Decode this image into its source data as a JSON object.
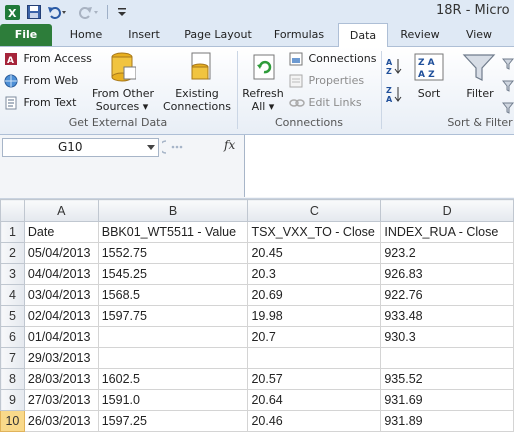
{
  "window": {
    "title": "18R - Micro"
  },
  "ribbon_tabs": [
    "File",
    "Home",
    "Insert",
    "Page Layout",
    "Formulas",
    "Data",
    "Review",
    "View"
  ],
  "active_tab": "Data",
  "get_external_data": {
    "from_access": "From Access",
    "from_web": "From Web",
    "from_text": "From Text",
    "from_other_sources_1": "From Other",
    "from_other_sources_2": "Sources ▾",
    "existing_connections_1": "Existing",
    "existing_connections_2": "Connections",
    "group_label": "Get External Data"
  },
  "connections": {
    "refresh_all_1": "Refresh",
    "refresh_all_2": "All ▾",
    "connections": "Connections",
    "properties": "Properties",
    "edit_links": "Edit Links",
    "group_label": "Connections"
  },
  "sort_filter": {
    "sort": "Sort",
    "filter": "Filter",
    "group_label": "Sort & Filter"
  },
  "formula_bar": {
    "name_box": "G10",
    "fx": "fx",
    "formula": ""
  },
  "sheet": {
    "columns": [
      "A",
      "B",
      "C",
      "D"
    ],
    "rows": [
      {
        "n": "1",
        "a": "Date",
        "b": "BBK01_WT5511 - Value",
        "c": "TSX_VXX_TO - Close",
        "d": "INDEX_RUA - Close"
      },
      {
        "n": "2",
        "a": "05/04/2013",
        "b": "1552.75",
        "c": "20.45",
        "d": "923.2"
      },
      {
        "n": "3",
        "a": "04/04/2013",
        "b": "1545.25",
        "c": "20.3",
        "d": "926.83"
      },
      {
        "n": "4",
        "a": "03/04/2013",
        "b": "1568.5",
        "c": "20.69",
        "d": "922.76"
      },
      {
        "n": "5",
        "a": "02/04/2013",
        "b": "1597.75",
        "c": "19.98",
        "d": "933.48"
      },
      {
        "n": "6",
        "a": "01/04/2013",
        "b": "",
        "c": "20.7",
        "d": "930.3"
      },
      {
        "n": "7",
        "a": "29/03/2013",
        "b": "",
        "c": "",
        "d": ""
      },
      {
        "n": "8",
        "a": "28/03/2013",
        "b": "1602.5",
        "c": "20.57",
        "d": "935.52"
      },
      {
        "n": "9",
        "a": "27/03/2013",
        "b": "1591.0",
        "c": "20.64",
        "d": "931.69"
      },
      {
        "n": "10",
        "a": "26/03/2013",
        "b": "1597.25",
        "c": "20.46",
        "d": "931.89"
      }
    ]
  }
}
